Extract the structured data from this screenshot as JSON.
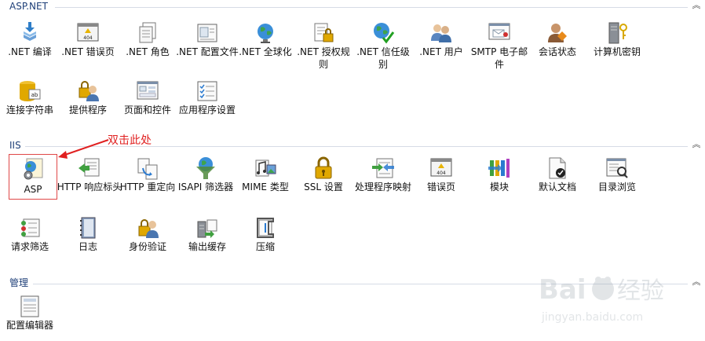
{
  "sections": {
    "aspnet": {
      "title": "ASP.NET"
    },
    "iis": {
      "title": "IIS"
    },
    "management": {
      "title": "管理"
    }
  },
  "aspnet_items": [
    {
      "label": ".NET 编译"
    },
    {
      "label": ".NET 错误页"
    },
    {
      "label": ".NET 角色"
    },
    {
      "label": ".NET 配置文件"
    },
    {
      "label": ".NET 全球化"
    },
    {
      "label": ".NET 授权规则"
    },
    {
      "label": ".NET 信任级别"
    },
    {
      "label": ".NET 用户"
    },
    {
      "label": "SMTP 电子邮件"
    },
    {
      "label": "会话状态"
    },
    {
      "label": "计算机密钥"
    },
    {
      "label": "连接字符串"
    },
    {
      "label": "提供程序"
    },
    {
      "label": "页面和控件"
    },
    {
      "label": "应用程序设置"
    }
  ],
  "iis_items": [
    {
      "label": "ASP"
    },
    {
      "label": "HTTP 响应标头"
    },
    {
      "label": "HTTP 重定向"
    },
    {
      "label": "ISAPI 筛选器"
    },
    {
      "label": "MIME 类型"
    },
    {
      "label": "SSL 设置"
    },
    {
      "label": "处理程序映射"
    },
    {
      "label": "错误页"
    },
    {
      "label": "模块"
    },
    {
      "label": "默认文档"
    },
    {
      "label": "目录浏览"
    },
    {
      "label": "请求筛选"
    },
    {
      "label": "日志"
    },
    {
      "label": "身份验证"
    },
    {
      "label": "输出缓存"
    },
    {
      "label": "压缩"
    }
  ],
  "management_items": [
    {
      "label": "配置编辑器"
    }
  ],
  "annotation": {
    "text": "双击此处",
    "color": "#e02020"
  },
  "watermark": {
    "brand": "Baidu经验",
    "url": "jingyan.baidu.com"
  },
  "colors": {
    "section_title": "#1e3f78",
    "selection_border": "#e04848"
  }
}
